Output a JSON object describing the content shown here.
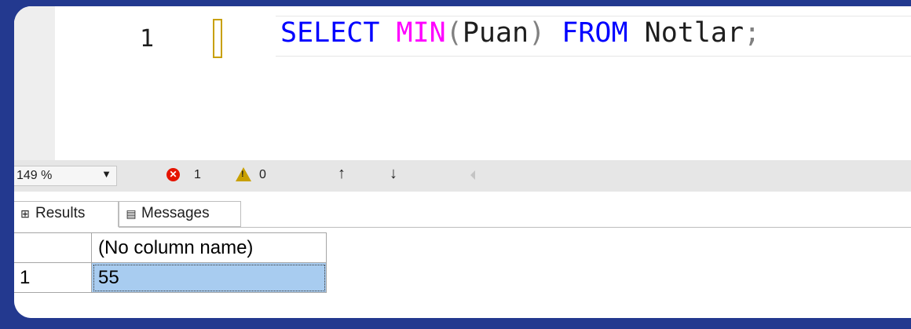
{
  "editor": {
    "line_number": "1",
    "code": {
      "select": "SELECT",
      "min": "MIN",
      "open_paren": "(",
      "column": "Puan",
      "close_paren": ")",
      "from": "FROM",
      "table": "Notlar",
      "semicolon": ";"
    }
  },
  "status_bar": {
    "zoom": "149 %",
    "errors": "1",
    "warnings": "0",
    "up_arrow": "↑",
    "down_arrow": "↓"
  },
  "results": {
    "tabs": [
      {
        "label": "Results",
        "icon": "grid-icon"
      },
      {
        "label": "Messages",
        "icon": "messages-icon"
      }
    ],
    "columns": [
      "(No column name)"
    ],
    "rows": [
      {
        "row_number": "1",
        "values": [
          "55"
        ]
      }
    ]
  },
  "colors": {
    "frame": "#23398f",
    "keyword": "#0000ff",
    "function": "#ff00ff",
    "selected_cell": "#a8ccf0",
    "error": "#e51400",
    "warning": "#c8a000"
  }
}
